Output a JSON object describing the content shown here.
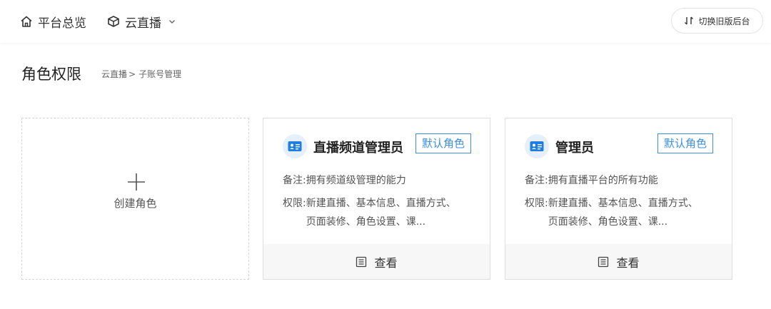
{
  "nav": {
    "home_label": "平台总览",
    "live_label": "云直播",
    "switch_label": "切换旧版后台"
  },
  "page": {
    "title": "角色权限",
    "breadcrumb": {
      "root": "云直播",
      "separator": ">",
      "current": "子账号管理"
    }
  },
  "create_card": {
    "label": "创建角色"
  },
  "roles": [
    {
      "name": "直播频道管理员",
      "badge": "默认角色",
      "note_key": "备注:",
      "note_value": "拥有频道级管理的能力",
      "perm_key": "权限:",
      "perm_value": "新建直播、基本信息、直播方式、页面装修、角色设置、课...",
      "view_label": "查看"
    },
    {
      "name": "管理员",
      "badge": "默认角色",
      "note_key": "备注:",
      "note_value": "拥有直播平台的所有功能",
      "perm_key": "权限:",
      "perm_value": "新建直播、基本信息、直播方式、页面装修、角色设置、课...",
      "view_label": "查看"
    }
  ],
  "colors": {
    "accent": "#3d8fdc",
    "icon_bg": "#e6f0fb",
    "footer_bg": "#f7f7f7"
  },
  "icons": {
    "home": "home-icon",
    "live": "cube-icon",
    "chevron": "chevron-down-icon",
    "switch": "switch-arrows-icon",
    "plus": "plus-icon",
    "role": "id-card-icon",
    "view": "document-icon"
  }
}
